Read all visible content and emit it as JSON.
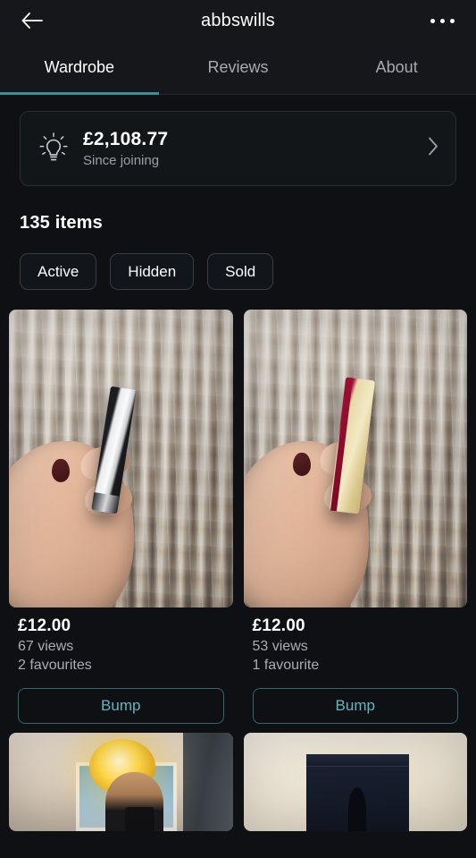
{
  "header": {
    "title": "abbswills",
    "back_icon": "arrow-left-icon",
    "more_icon": "more-horizontal-icon"
  },
  "tabs": [
    {
      "label": "Wardrobe",
      "active": true
    },
    {
      "label": "Reviews",
      "active": false
    },
    {
      "label": "About",
      "active": false
    }
  ],
  "earnings": {
    "icon": "lightbulb-icon",
    "amount": "£2,108.77",
    "subtitle": "Since joining",
    "chevron_icon": "chevron-right-icon"
  },
  "wardrobe": {
    "count_label": "135 items",
    "filters": [
      {
        "label": "Active"
      },
      {
        "label": "Hidden"
      },
      {
        "label": "Sold"
      }
    ],
    "items": [
      {
        "photo": "hand holding black and silver lipstick on grey fur blanket",
        "price": "£12.00",
        "views": "67 views",
        "favourites": "2 favourites",
        "action_label": "Bump"
      },
      {
        "photo": "hand holding red and gold Bobbi Brown lipstick box on grey fur blanket",
        "price": "£12.00",
        "views": "53 views",
        "favourites": "1 favourite",
        "action_label": "Bump"
      },
      {
        "photo": "mirror selfie in bay window room with gold pendant light"
      },
      {
        "photo": "dark navy jeans laid flat on white bedding"
      }
    ]
  },
  "colors": {
    "background": "#0e1013",
    "surface": "#15171a",
    "accent_teal": "#3a8d99",
    "accent_teal_text": "#62b6bf",
    "text_primary": "#ffffff",
    "text_secondary": "#a9aeb3",
    "border": "#2a2d31"
  }
}
